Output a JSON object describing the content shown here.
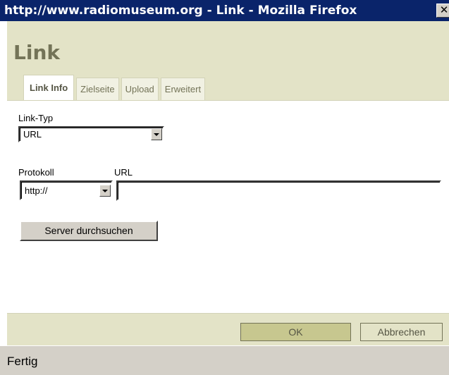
{
  "window": {
    "title": "http://www.radiomuseum.org - Link - Mozilla Firefox",
    "close_label": "✕"
  },
  "dialog": {
    "title": "Link",
    "tabs": [
      {
        "label": "Link Info",
        "active": true
      },
      {
        "label": "Zielseite",
        "active": false
      },
      {
        "label": "Upload",
        "active": false
      },
      {
        "label": "Erweitert",
        "active": false
      }
    ]
  },
  "form": {
    "link_type_label": "Link-Typ",
    "link_type_value": "URL",
    "protocol_label": "Protokoll",
    "protocol_value": "http://",
    "url_label": "URL",
    "url_value": "",
    "browse_server_label": "Server durchsuchen"
  },
  "footer": {
    "ok_label": "OK",
    "cancel_label": "Abbrechen"
  },
  "status": {
    "text": "Fertig"
  },
  "colors": {
    "titlebar": "#0a246a",
    "dialog_chrome": "#e3e3c7",
    "accent_text": "#737357",
    "ok_button": "#c7c78f"
  }
}
